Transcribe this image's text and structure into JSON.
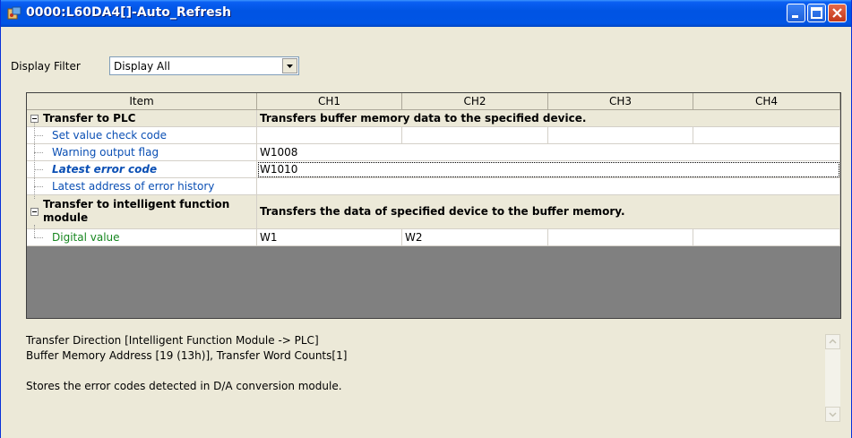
{
  "window": {
    "title": "0000:L60DA4[]-Auto_Refresh",
    "controls": [
      "minimize",
      "maximize",
      "close"
    ]
  },
  "filter": {
    "label": "Display Filter",
    "selected": "Display All"
  },
  "table": {
    "headers": [
      "Item",
      "CH1",
      "CH2",
      "CH3",
      "CH4"
    ],
    "groups": [
      {
        "label": "Transfer to PLC",
        "description": "Transfers buffer memory data to the specified device.",
        "items": [
          {
            "label": "Set value check code",
            "values": [
              "",
              "",
              "",
              ""
            ]
          },
          {
            "label": "Warning output flag",
            "values": [
              "W1008"
            ]
          },
          {
            "label": "Latest error code",
            "values": [
              "W1010"
            ]
          },
          {
            "label": "Latest address of error history",
            "values": [
              ""
            ]
          }
        ]
      },
      {
        "label_line1": "Transfer to intelligent function",
        "label_line2": "module",
        "description": "Transfers the data of specified device to the buffer memory.",
        "items": [
          {
            "label": "Digital value",
            "values": [
              "W1",
              "W2",
              "",
              ""
            ]
          }
        ]
      }
    ]
  },
  "details": {
    "line1": "Transfer Direction [Intelligent Function Module -> PLC]",
    "line2": "Buffer Memory Address [19 (13h)], Transfer Word Counts[1]",
    "line3": "Stores the error codes detected in D/A conversion module."
  },
  "colors": {
    "title_bar": "#0054e3",
    "window_bg": "#ece9d8",
    "item_blue": "#0a4fb4",
    "item_green": "#16861f",
    "grid_empty": "#808080"
  }
}
